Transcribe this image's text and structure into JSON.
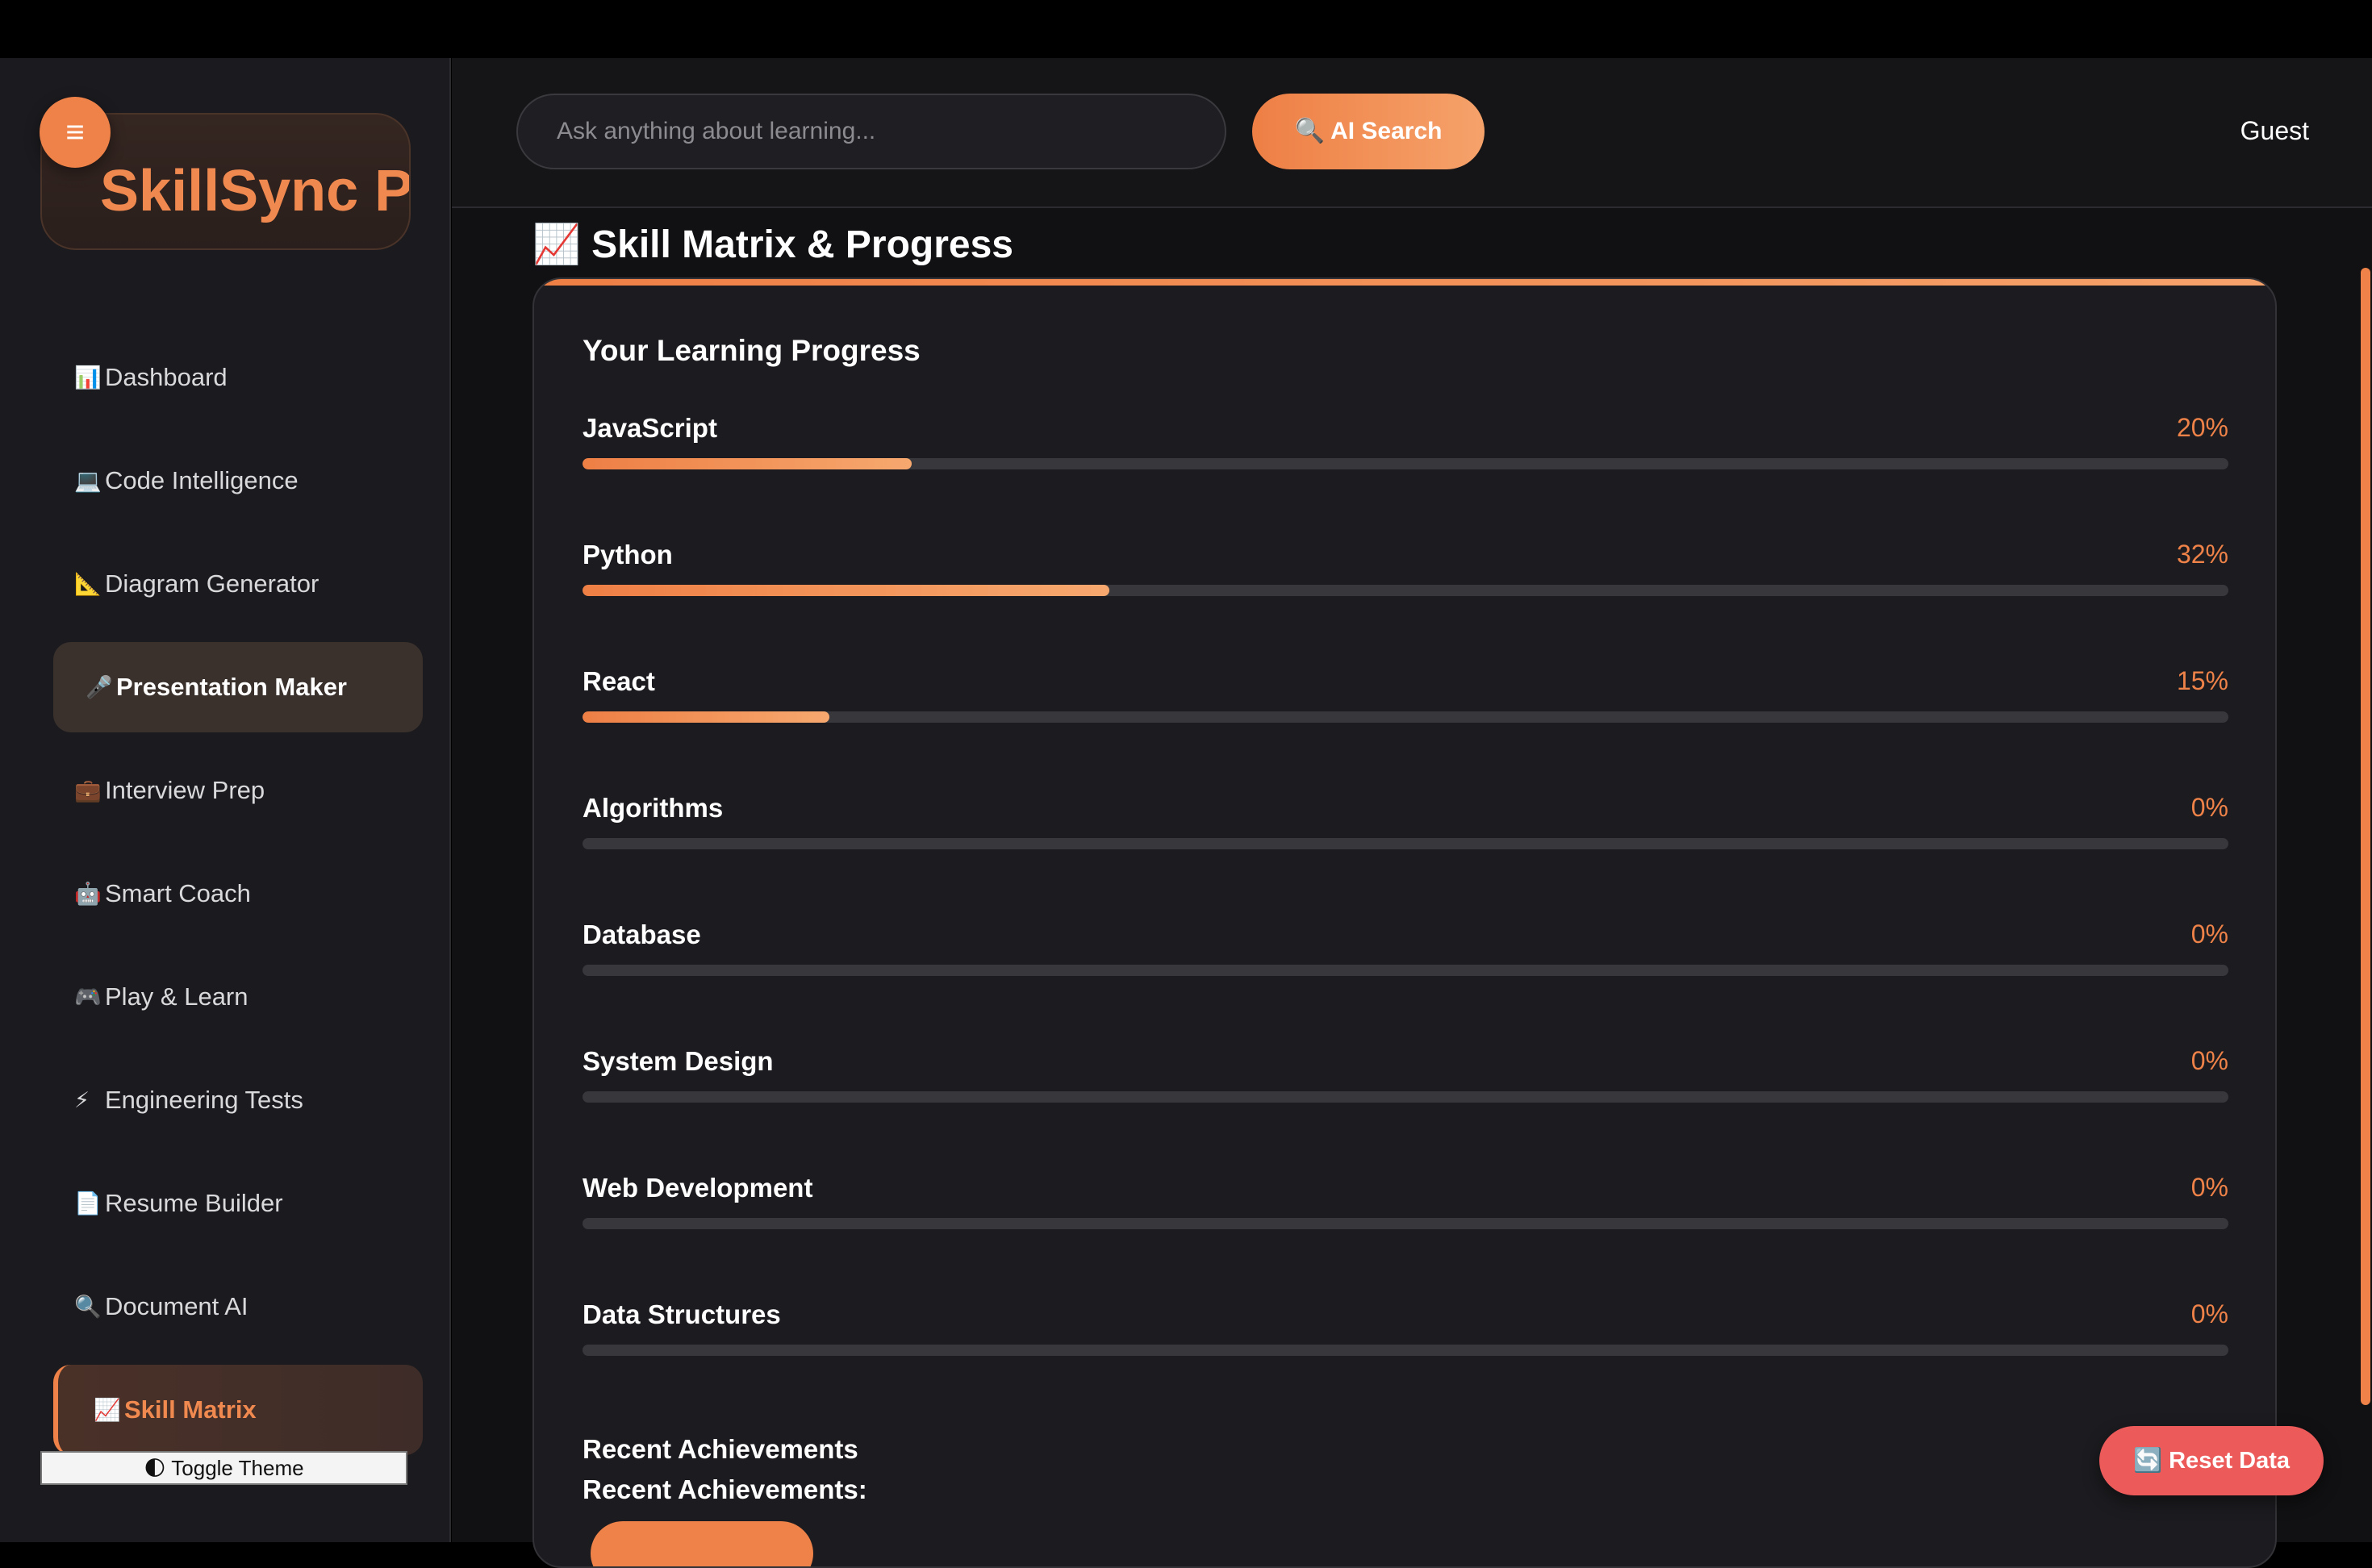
{
  "sidebar": {
    "logo_text": "SkillSync Pro",
    "menu_toggle_icon": "≡",
    "items": [
      {
        "icon": "📊",
        "label": "Dashboard"
      },
      {
        "icon": "💻",
        "label": "Code Intelligence"
      },
      {
        "icon": "📐",
        "label": "Diagram Generator"
      },
      {
        "icon": "🎤",
        "label": "Presentation Maker"
      },
      {
        "icon": "💼",
        "label": "Interview Prep"
      },
      {
        "icon": "🤖",
        "label": "Smart Coach"
      },
      {
        "icon": "🎮",
        "label": "Play & Learn"
      },
      {
        "icon": "⚡",
        "label": "Engineering Tests"
      },
      {
        "icon": "📄",
        "label": "Resume Builder"
      },
      {
        "icon": "🔍",
        "label": "Document AI"
      },
      {
        "icon": "📈",
        "label": "Skill Matrix"
      }
    ],
    "hovered_item": "Presentation Maker",
    "active_item": "Skill Matrix",
    "theme_toggle": "🌓 Toggle Theme"
  },
  "header": {
    "search_placeholder": "Ask anything about learning...",
    "search_button": "🔍 AI Search",
    "user": "Guest"
  },
  "main": {
    "page_title": "📈 Skill Matrix & Progress",
    "card_title": "Your Learning Progress",
    "skills": [
      {
        "name": "JavaScript",
        "percent": 20,
        "label": "20%"
      },
      {
        "name": "Python",
        "percent": 32,
        "label": "32%"
      },
      {
        "name": "React",
        "percent": 15,
        "label": "15%"
      },
      {
        "name": "Algorithms",
        "percent": 0,
        "label": "0%"
      },
      {
        "name": "Database",
        "percent": 0,
        "label": "0%"
      },
      {
        "name": "System Design",
        "percent": 0,
        "label": "0%"
      },
      {
        "name": "Web Development",
        "percent": 0,
        "label": "0%"
      },
      {
        "name": "Data Structures",
        "percent": 0,
        "label": "0%"
      }
    ],
    "achievements_heading": "Recent Achievements",
    "achievements_subheading": "Recent Achievements:"
  },
  "reset_button": "🔄 Reset Data",
  "colors": {
    "accent": "#ee8248",
    "reset": "#ec5a5a",
    "background": "#111113",
    "sidebar": "#1b1b1f"
  }
}
